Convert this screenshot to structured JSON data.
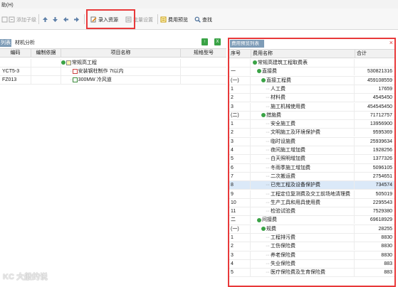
{
  "window": {
    "title": "助(H)"
  },
  "toolbar": {
    "add_sub_label": "添加子级",
    "import_resource_label": "录入资源",
    "batch_settings_label": "批量设置",
    "cost_preview_label": "费用预览",
    "search_label": "查找"
  },
  "left_panel": {
    "active_tab": "列表",
    "second_tab": "材机分析",
    "columns": [
      "编码",
      "编制依据",
      "项目名称",
      "规格型号"
    ],
    "rows": [
      {
        "code": "",
        "basis": "",
        "name": "常规高工程",
        "spec": ""
      },
      {
        "code": "YCT5-3",
        "basis": "",
        "name": "安装钢柱制作 7t以内",
        "spec": ""
      },
      {
        "code": "FZ013",
        "basis": "",
        "name": "300MW 冷风道",
        "spec": ""
      }
    ]
  },
  "right_panel": {
    "tab_label": "费用预览列表",
    "close_glyph": "×",
    "columns": [
      "序号",
      "费用名称",
      "合计"
    ],
    "rows": [
      {
        "seq": "",
        "name": "常规高建筑工程取费表",
        "total": "",
        "level": 0,
        "node": true
      },
      {
        "seq": "一",
        "name": "直接费",
        "total": "530821316",
        "level": 1,
        "node": true
      },
      {
        "seq": "(一)",
        "name": "直接工程费",
        "total": "459108559",
        "level": 2,
        "node": true
      },
      {
        "seq": "1",
        "name": "人工费",
        "total": "17659",
        "level": 3,
        "node": false
      },
      {
        "seq": "2",
        "name": "材料费",
        "total": "4545450",
        "level": 3,
        "node": false
      },
      {
        "seq": "3",
        "name": "施工机械使用费",
        "total": "454545450",
        "level": 3,
        "node": false
      },
      {
        "seq": "(二)",
        "name": "措施费",
        "total": "71712757",
        "level": 2,
        "node": true
      },
      {
        "seq": "1",
        "name": "安全施工费",
        "total": "13956900",
        "level": 3,
        "node": false
      },
      {
        "seq": "2",
        "name": "文明施工及环境保护费",
        "total": "9595369",
        "level": 3,
        "node": false
      },
      {
        "seq": "3",
        "name": "临时设施费",
        "total": "25939634",
        "level": 3,
        "node": false
      },
      {
        "seq": "4",
        "name": "夜间施工增加费",
        "total": "1928256",
        "level": 3,
        "node": false
      },
      {
        "seq": "5",
        "name": "白天照明增加费",
        "total": "1377326",
        "level": 3,
        "node": false
      },
      {
        "seq": "6",
        "name": "冬雨季施工增加费",
        "total": "5096105",
        "level": 3,
        "node": false
      },
      {
        "seq": "7",
        "name": "二次搬运费",
        "total": "2754651",
        "level": 3,
        "node": false
      },
      {
        "seq": "8",
        "name": "已完工程及设备保护费",
        "total": "734574",
        "level": 3,
        "node": false,
        "selected": true
      },
      {
        "seq": "9",
        "name": "工程定位复测费及交工前场地清理费",
        "total": "505019",
        "level": 3,
        "node": false
      },
      {
        "seq": "10",
        "name": "生产工具和用具使用费",
        "total": "2295543",
        "level": 3,
        "node": false
      },
      {
        "seq": "11",
        "name": "检验试验费",
        "total": "7529380",
        "level": 3,
        "node": false
      },
      {
        "seq": "二",
        "name": "间接费",
        "total": "69618929",
        "level": 1,
        "node": true
      },
      {
        "seq": "(一)",
        "name": "规费",
        "total": "28255",
        "level": 2,
        "node": true
      },
      {
        "seq": "1",
        "name": "工程排污费",
        "total": "8830",
        "level": 3,
        "node": false
      },
      {
        "seq": "2",
        "name": "工伤保险费",
        "total": "8830",
        "level": 3,
        "node": false
      },
      {
        "seq": "3",
        "name": "养老保险费",
        "total": "8830",
        "level": 3,
        "node": false
      },
      {
        "seq": "4",
        "name": "失业保险费",
        "total": "883",
        "level": 3,
        "node": false
      },
      {
        "seq": "5",
        "name": "医疗保险费及生育保险费",
        "total": "883",
        "level": 3,
        "node": false
      }
    ]
  },
  "watermark": "KC 大般的说"
}
